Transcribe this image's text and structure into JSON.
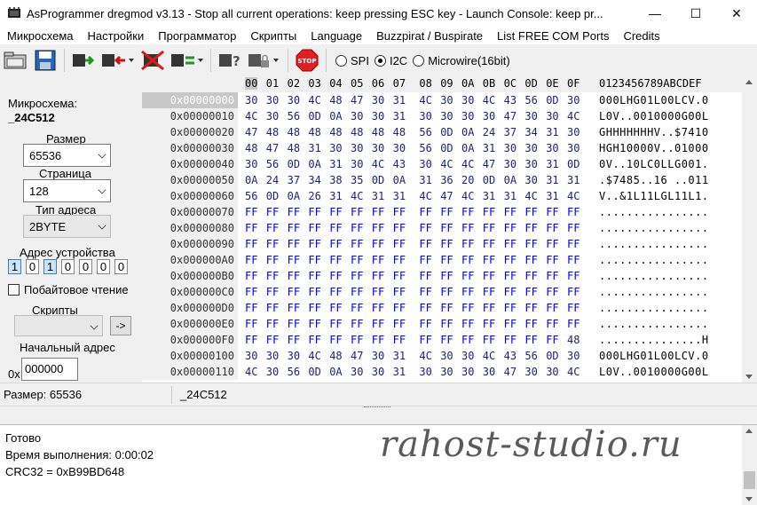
{
  "window": {
    "title": "AsProgrammer dregmod v3.13 - Stop all current operations: keep pressing ESC key - Launch Console: keep pr...",
    "minimize": "—",
    "maximize": "☐",
    "close": "✕"
  },
  "menu": [
    "Микросхема",
    "Настройки",
    "Программатор",
    "Скрипты",
    "Language",
    "Buzzpirat / Buspirate",
    "List FREE COM Ports",
    "Credits"
  ],
  "toolbar": {
    "buttons": [
      "open-icon",
      "save-icon",
      "read-chip-icon",
      "write-chip-icon",
      "erase-chip-icon",
      "verify-chip-icon",
      "check-blank-icon",
      "lock-chip-icon",
      "stop-icon"
    ],
    "stop_label": "STOP",
    "protocols": [
      {
        "label": "SPI",
        "selected": false
      },
      {
        "label": "I2C",
        "selected": true
      },
      {
        "label": "Microwire(16bit)",
        "selected": false
      }
    ]
  },
  "left": {
    "chip_label": "Микросхема:",
    "chip_name": "_24C512",
    "size_label": "Размер",
    "size_value": "65536",
    "page_label": "Страница",
    "page_value": "128",
    "addrtype_label": "Тип адреса",
    "addrtype_value": "2BYTE",
    "devaddr_label": "Адрес устройства",
    "devaddr_bits": [
      "1",
      "0",
      "1",
      "0",
      "0",
      "0",
      "0"
    ],
    "bytewise_label": "Побайтовое чтение",
    "scripts_label": "Скрипты",
    "scripts_value": "",
    "run_script": "->",
    "start_label": "Начальный адрес",
    "start_prefix": "0x",
    "start_value": "000000"
  },
  "hex": {
    "columns": [
      "00",
      "01",
      "02",
      "03",
      "04",
      "05",
      "06",
      "07",
      "08",
      "09",
      "0A",
      "0B",
      "0C",
      "0D",
      "0E",
      "0F"
    ],
    "ascii_header": "0123456789ABCDEF",
    "rows": [
      {
        "addr": "0x00000000",
        "bytes": [
          "30",
          "30",
          "30",
          "4C",
          "48",
          "47",
          "30",
          "31",
          "4C",
          "30",
          "30",
          "4C",
          "43",
          "56",
          "0D",
          "30"
        ],
        "ascii": "000LHG01L00LCV.0"
      },
      {
        "addr": "0x00000010",
        "bytes": [
          "4C",
          "30",
          "56",
          "0D",
          "0A",
          "30",
          "30",
          "31",
          "30",
          "30",
          "30",
          "30",
          "47",
          "30",
          "30",
          "4C"
        ],
        "ascii": "L0V..0010000G00L"
      },
      {
        "addr": "0x00000020",
        "bytes": [
          "47",
          "48",
          "48",
          "48",
          "48",
          "48",
          "48",
          "48",
          "56",
          "0D",
          "0A",
          "24",
          "37",
          "34",
          "31",
          "30"
        ],
        "ascii": "GHHHHHHHV..$7410"
      },
      {
        "addr": "0x00000030",
        "bytes": [
          "48",
          "47",
          "48",
          "31",
          "30",
          "30",
          "30",
          "30",
          "56",
          "0D",
          "0A",
          "31",
          "30",
          "30",
          "30",
          "30"
        ],
        "ascii": "HGH10000V..01000"
      },
      {
        "addr": "0x00000040",
        "bytes": [
          "30",
          "56",
          "0D",
          "0A",
          "31",
          "30",
          "4C",
          "43",
          "30",
          "4C",
          "4C",
          "47",
          "30",
          "30",
          "31",
          "0D"
        ],
        "ascii": "0V..10LC0LLG001."
      },
      {
        "addr": "0x00000050",
        "bytes": [
          "0A",
          "24",
          "37",
          "34",
          "38",
          "35",
          "0D",
          "0A",
          "31",
          "36",
          "20",
          "0D",
          "0A",
          "30",
          "31",
          "31"
        ],
        "ascii": ".$7485..16 ..011"
      },
      {
        "addr": "0x00000060",
        "bytes": [
          "56",
          "0D",
          "0A",
          "26",
          "31",
          "4C",
          "31",
          "31",
          "4C",
          "47",
          "4C",
          "31",
          "31",
          "4C",
          "31",
          "4C"
        ],
        "ascii": "V..&1L11LGL11L1."
      },
      {
        "addr": "0x00000070",
        "bytes": [
          "FF",
          "FF",
          "FF",
          "FF",
          "FF",
          "FF",
          "FF",
          "FF",
          "FF",
          "FF",
          "FF",
          "FF",
          "FF",
          "FF",
          "FF",
          "FF"
        ],
        "ascii": "................"
      },
      {
        "addr": "0x00000080",
        "bytes": [
          "FF",
          "FF",
          "FF",
          "FF",
          "FF",
          "FF",
          "FF",
          "FF",
          "FF",
          "FF",
          "FF",
          "FF",
          "FF",
          "FF",
          "FF",
          "FF"
        ],
        "ascii": "................"
      },
      {
        "addr": "0x00000090",
        "bytes": [
          "FF",
          "FF",
          "FF",
          "FF",
          "FF",
          "FF",
          "FF",
          "FF",
          "FF",
          "FF",
          "FF",
          "FF",
          "FF",
          "FF",
          "FF",
          "FF"
        ],
        "ascii": "................"
      },
      {
        "addr": "0x000000A0",
        "bytes": [
          "FF",
          "FF",
          "FF",
          "FF",
          "FF",
          "FF",
          "FF",
          "FF",
          "FF",
          "FF",
          "FF",
          "FF",
          "FF",
          "FF",
          "FF",
          "FF"
        ],
        "ascii": "................"
      },
      {
        "addr": "0x000000B0",
        "bytes": [
          "FF",
          "FF",
          "FF",
          "FF",
          "FF",
          "FF",
          "FF",
          "FF",
          "FF",
          "FF",
          "FF",
          "FF",
          "FF",
          "FF",
          "FF",
          "FF"
        ],
        "ascii": "................"
      },
      {
        "addr": "0x000000C0",
        "bytes": [
          "FF",
          "FF",
          "FF",
          "FF",
          "FF",
          "FF",
          "FF",
          "FF",
          "FF",
          "FF",
          "FF",
          "FF",
          "FF",
          "FF",
          "FF",
          "FF"
        ],
        "ascii": "................"
      },
      {
        "addr": "0x000000D0",
        "bytes": [
          "FF",
          "FF",
          "FF",
          "FF",
          "FF",
          "FF",
          "FF",
          "FF",
          "FF",
          "FF",
          "FF",
          "FF",
          "FF",
          "FF",
          "FF",
          "FF"
        ],
        "ascii": "................"
      },
      {
        "addr": "0x000000E0",
        "bytes": [
          "FF",
          "FF",
          "FF",
          "FF",
          "FF",
          "FF",
          "FF",
          "FF",
          "FF",
          "FF",
          "FF",
          "FF",
          "FF",
          "FF",
          "FF",
          "FF"
        ],
        "ascii": "................"
      },
      {
        "addr": "0x000000F0",
        "bytes": [
          "FF",
          "FF",
          "FF",
          "FF",
          "FF",
          "FF",
          "FF",
          "FF",
          "FF",
          "FF",
          "FF",
          "FF",
          "FF",
          "FF",
          "FF",
          "48"
        ],
        "ascii": "...............H"
      },
      {
        "addr": "0x00000100",
        "bytes": [
          "30",
          "30",
          "30",
          "4C",
          "48",
          "47",
          "30",
          "31",
          "4C",
          "30",
          "30",
          "4C",
          "43",
          "56",
          "0D",
          "30"
        ],
        "ascii": "000LHG01L00LCV.0"
      },
      {
        "addr": "0x00000110",
        "bytes": [
          "4C",
          "30",
          "56",
          "0D",
          "0A",
          "30",
          "30",
          "31",
          "30",
          "30",
          "30",
          "30",
          "47",
          "30",
          "30",
          "4C"
        ],
        "ascii": "L0V..0010000G00L"
      }
    ]
  },
  "status": {
    "size_text": "Размер: 65536",
    "chip_text": "_24C512"
  },
  "console": {
    "lines": [
      "Готово",
      "Время выполнения: 0:00:02",
      "CRC32 = 0xB99BD648"
    ]
  },
  "watermark": "rahost-studio.ru"
}
